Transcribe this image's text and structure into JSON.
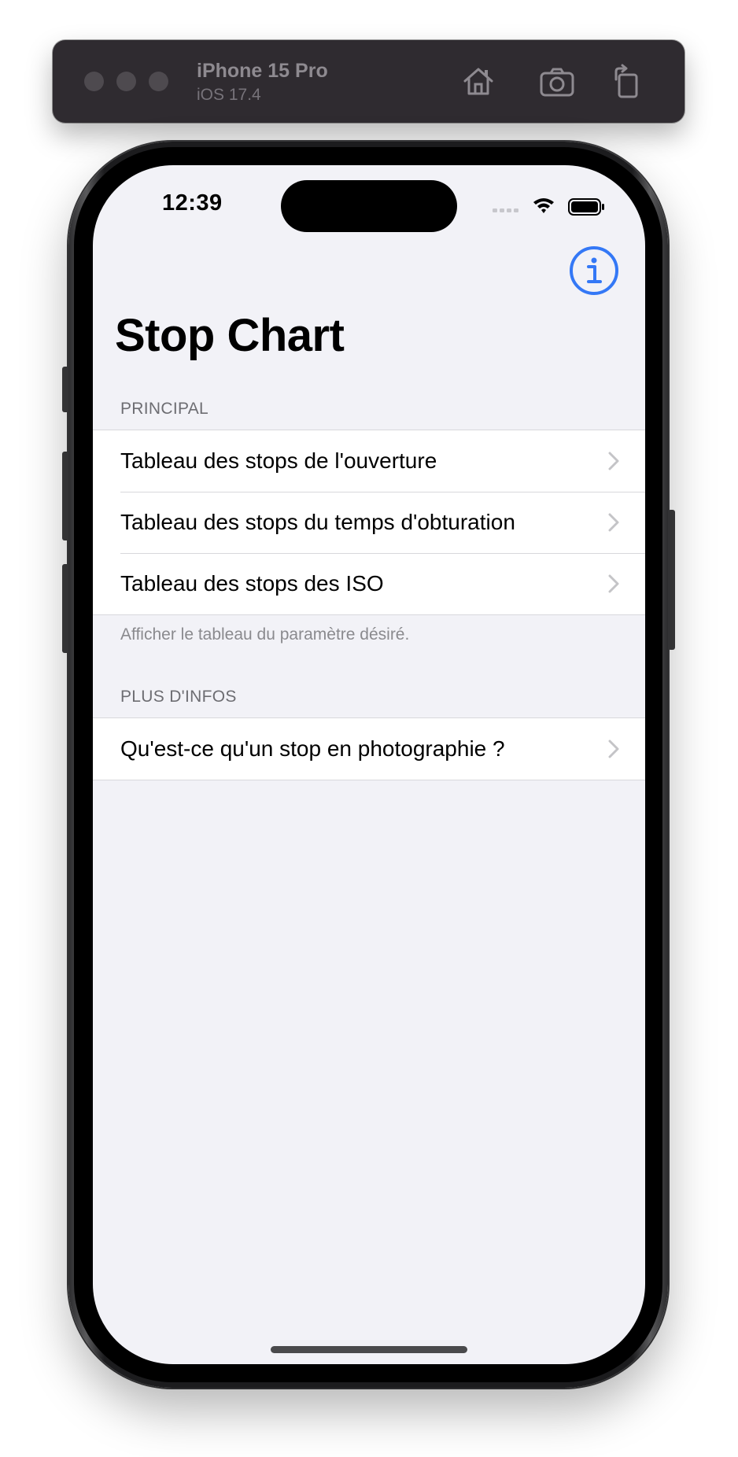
{
  "simulator": {
    "device_name": "iPhone 15 Pro",
    "os_version": "iOS 17.4",
    "toolbar_icons": [
      "home-icon",
      "screenshot-icon",
      "rotate-icon"
    ]
  },
  "status_bar": {
    "time": "12:39",
    "icons": [
      "cellular-signal-icon",
      "wifi-icon",
      "battery-icon"
    ]
  },
  "nav": {
    "title": "Stop Chart",
    "right_icon": "info-icon",
    "accent_color": "#3478f6"
  },
  "sections": [
    {
      "header": "PRINCIPAL",
      "rows": [
        {
          "label": "Tableau des stops de l'ouverture"
        },
        {
          "label": "Tableau des stops du temps d'obturation"
        },
        {
          "label": "Tableau des stops des ISO"
        }
      ],
      "footer": "Afficher le tableau du paramètre désiré."
    },
    {
      "header": "PLUS D'INFOS",
      "rows": [
        {
          "label": "Qu'est-ce qu'un stop en photographie ?"
        }
      ]
    }
  ]
}
